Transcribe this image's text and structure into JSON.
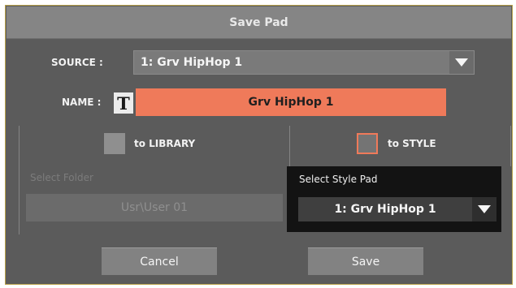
{
  "dialog": {
    "title": "Save Pad"
  },
  "source": {
    "label": "SOURCE :",
    "value": "1: Grv HipHop 1"
  },
  "name": {
    "label": "NAME :",
    "t_icon": "T",
    "value": "Grv HipHop 1"
  },
  "targets": {
    "library": {
      "label": "to LIBRARY",
      "checked": false
    },
    "style": {
      "label": "to STYLE",
      "checked": true
    }
  },
  "folder": {
    "label": "Select Folder",
    "value": "Usr\\User 01"
  },
  "style_pad": {
    "label": "Select Style Pad",
    "value": "1: Grv HipHop 1"
  },
  "buttons": {
    "cancel": "Cancel",
    "save": "Save"
  },
  "colors": {
    "accent": "#ef7a5a",
    "dialog_bg": "#5b5b5b",
    "title_bg": "#858585"
  },
  "icons": {
    "dropdown": "chevron-down-icon",
    "text_edit": "text-edit-icon"
  }
}
